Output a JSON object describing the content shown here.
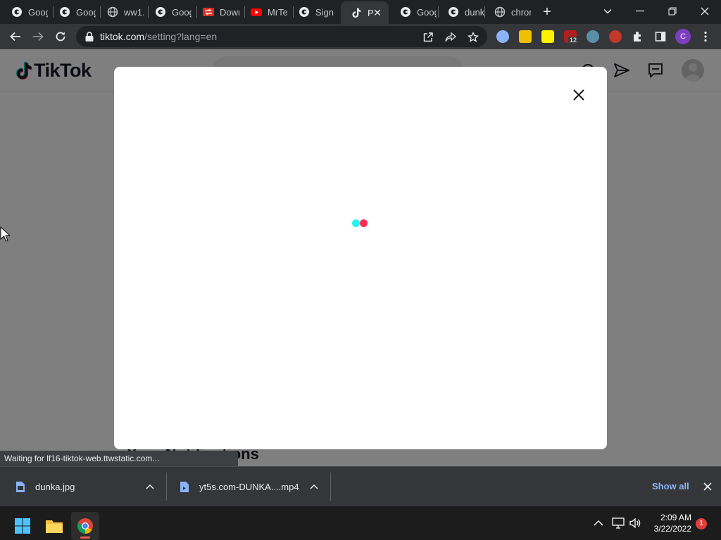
{
  "browser": {
    "tabs": [
      {
        "title": "Goog",
        "icon": "google-icon"
      },
      {
        "title": "Goog",
        "icon": "google-icon"
      },
      {
        "title": "ww1.",
        "icon": "globe-icon"
      },
      {
        "title": "Goog",
        "icon": "google-icon"
      },
      {
        "title": "Down",
        "icon": "download-site-icon"
      },
      {
        "title": "MrTe",
        "icon": "youtube-icon"
      },
      {
        "title": "Sign",
        "icon": "google-icon"
      },
      {
        "title": "P",
        "icon": "tiktok-icon",
        "active": true
      },
      {
        "title": "Goog",
        "icon": "google-icon"
      },
      {
        "title": "dunk",
        "icon": "google-icon"
      },
      {
        "title": "chror",
        "icon": "globe-icon"
      }
    ],
    "url_host": "tiktok.com",
    "url_path": "/setting?lang=en",
    "extension_badge": "12",
    "profile_initial": "C"
  },
  "page": {
    "logo_text": "TikTok",
    "section_heading": "Your Notifications",
    "status_text": "Waiting for lf16-tiktok-web.ttwstatic.com...",
    "loader_colors": [
      "#25F4EE",
      "#FE2C55"
    ]
  },
  "downloads": {
    "items": [
      {
        "name": "dunka.jpg"
      },
      {
        "name": "yt5s.com-DUNKA....mp4"
      }
    ],
    "show_all": "Show all"
  },
  "taskbar": {
    "time": "2:09 AM",
    "date": "3/22/2022",
    "notification_count": "1"
  },
  "colors": {
    "accent": "#FE2C55",
    "cyan": "#25F4EE",
    "link": "#8ab4f8"
  }
}
